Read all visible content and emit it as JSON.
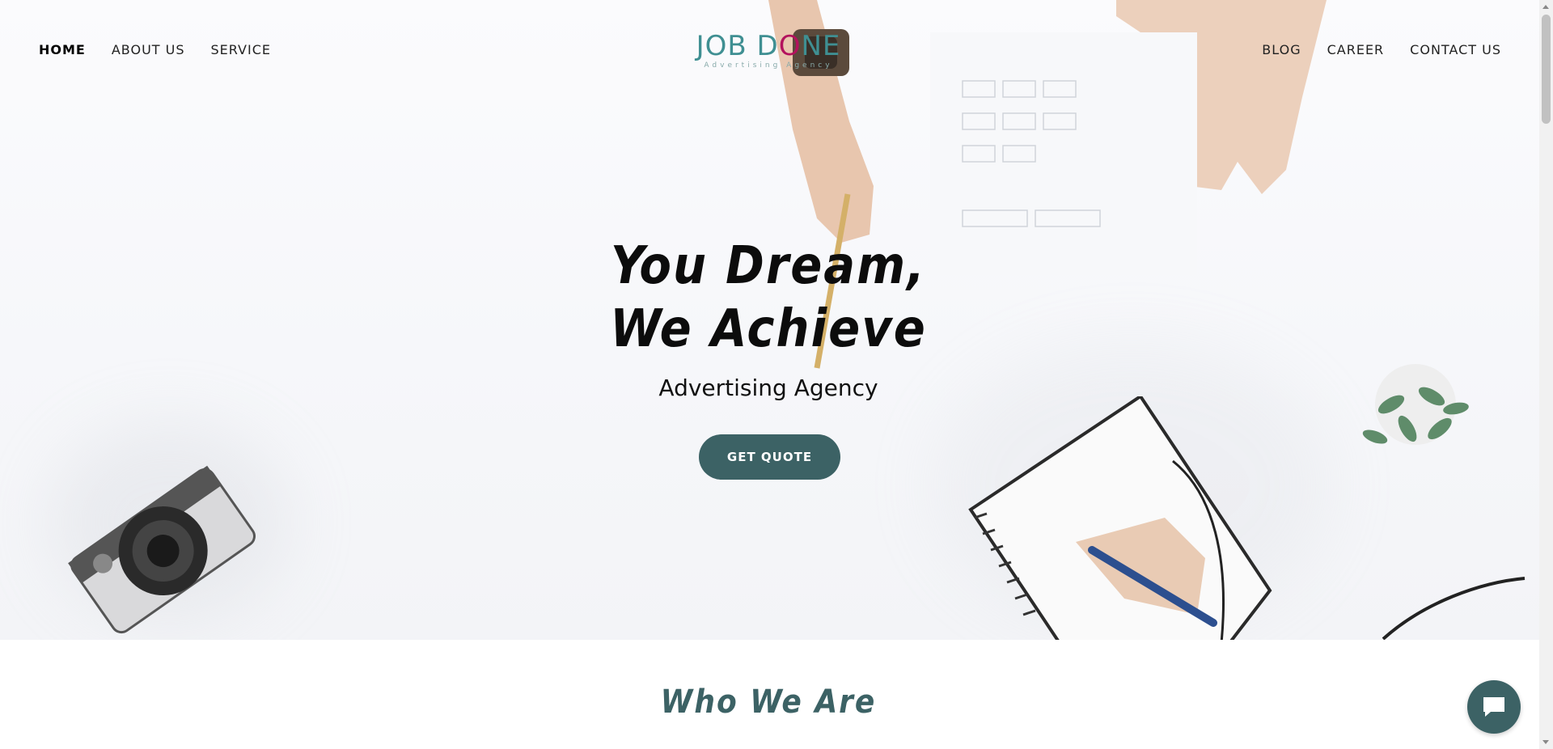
{
  "nav": {
    "left": [
      {
        "label": "HOME",
        "active": true
      },
      {
        "label": "ABOUT US",
        "active": false
      },
      {
        "label": "SERVICE",
        "active": false
      }
    ],
    "right": [
      {
        "label": "BLOG"
      },
      {
        "label": "CAREER"
      },
      {
        "label": "CONTACT US"
      }
    ]
  },
  "logo": {
    "text_left": "JOB D",
    "text_o": "O",
    "text_right": "NE",
    "tagline": "Advertising Agency"
  },
  "hero": {
    "title": "You Dream,\nWe Achieve",
    "subtitle": "Advertising Agency",
    "cta_label": "GET QUOTE"
  },
  "section": {
    "title": "Who We Are"
  },
  "chat": {
    "icon": "chat-bubble-icon"
  },
  "colors": {
    "brand_teal": "#3c6265",
    "logo_teal": "#3f8f92",
    "logo_accent": "#b3125d",
    "top_line": "#1f6f6a"
  }
}
